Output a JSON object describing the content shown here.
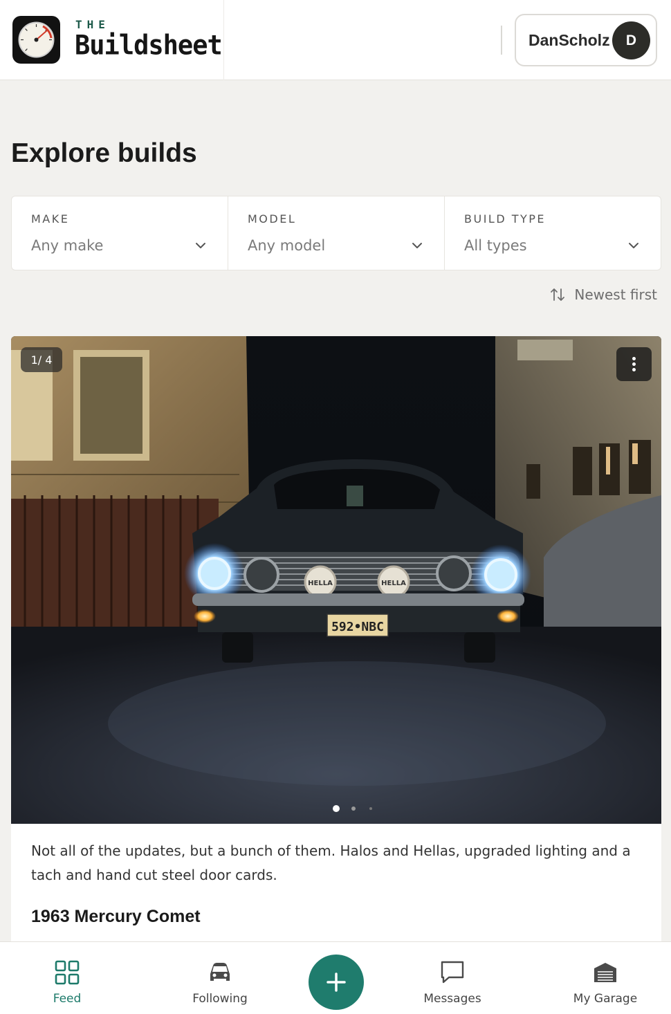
{
  "header": {
    "brand_small": "THE",
    "brand_name": "Buildsheet",
    "user_name": "DanScholz",
    "avatar_initial": "D"
  },
  "page": {
    "title": "Explore builds"
  },
  "filters": [
    {
      "label": "MAKE",
      "value": "Any make"
    },
    {
      "label": "MODEL",
      "value": "Any model"
    },
    {
      "label": "BUILD TYPE",
      "value": "All types"
    }
  ],
  "sort": {
    "label": "Newest first"
  },
  "post": {
    "image_counter": "1/ 4",
    "caption": "Not all of the updates, but a bunch of them. Halos and Hellas, upgraded lighting and a tach and hand cut steel door cards.",
    "car": "1963 Mercury Comet",
    "plate": "592•NBC",
    "lamp_label": "HELLA",
    "carousel_active_index": 0,
    "carousel_visible_dots": 3
  },
  "bottom_nav": {
    "items": [
      {
        "label": "Feed",
        "icon": "grid-icon",
        "active": true
      },
      {
        "label": "Following",
        "icon": "car-icon",
        "active": false
      },
      {
        "label": "Messages",
        "icon": "message-icon",
        "active": false
      },
      {
        "label": "My Garage",
        "icon": "garage-icon",
        "active": false
      }
    ],
    "fab_icon": "plus-icon"
  },
  "colors": {
    "accent": "#1f7c6d",
    "background": "#f2f1ee",
    "brand_green": "#1d5a4a"
  }
}
